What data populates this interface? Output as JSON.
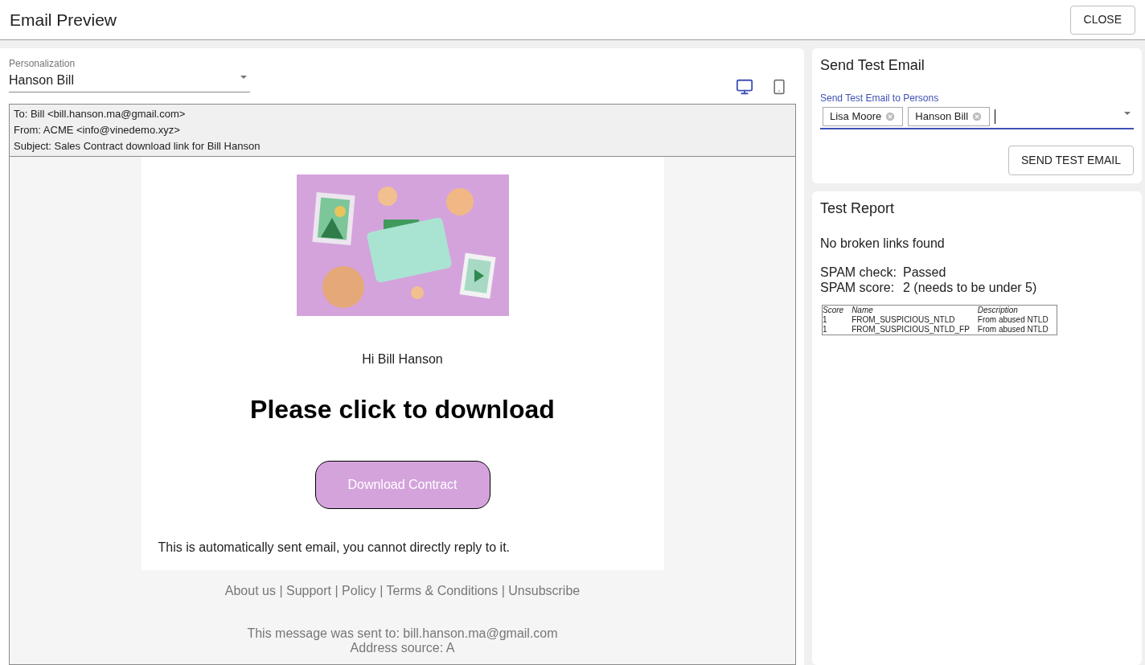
{
  "header": {
    "title": "Email Preview",
    "close_button": "CLOSE"
  },
  "preview": {
    "personalization": {
      "label": "Personalization",
      "value": "Hanson Bill"
    },
    "view_modes": [
      {
        "kind": "desktop",
        "selected": true
      },
      {
        "kind": "mobile",
        "selected": false
      }
    ],
    "envelope": [
      "To: Bill <bill.hanson.ma@gmail.com>",
      "From: ACME <info@vinedemo.xyz>",
      "Subject: Sales Contract download link for Bill Hanson"
    ],
    "email": {
      "greeting": "Hi Bill Hanson",
      "heading": "Please click to download",
      "button": "Download Contract",
      "note": "This is automatically sent email, you cannot directly reply to it.",
      "footer_links": "About us | Support | Policy | Terms & Conditions | Unsubscribe",
      "sent_to": "This message was sent to: bill.hanson.ma@gmail.com",
      "address_source": "Address source: A"
    }
  },
  "send_test": {
    "title": "Send Test Email",
    "field_label": "Send Test Email to Persons",
    "chips": [
      "Lisa Moore",
      "Hanson Bill"
    ],
    "button": "SEND TEST EMAIL"
  },
  "report": {
    "title": "Test Report",
    "links": "No broken links found",
    "spam": [
      {
        "label": "SPAM check:",
        "value": "Passed"
      },
      {
        "label": "SPAM score:",
        "value": "2 (needs to be under 5)"
      }
    ],
    "table": {
      "columns": [
        "Score",
        "Name",
        "Description"
      ],
      "rows": [
        [
          "1",
          "FROM_SUSPICIOUS_NTLD",
          "From abused NTLD"
        ],
        [
          "1",
          "FROM_SUSPICIOUS_NTLD_FP",
          "From abused NTLD"
        ]
      ]
    }
  }
}
